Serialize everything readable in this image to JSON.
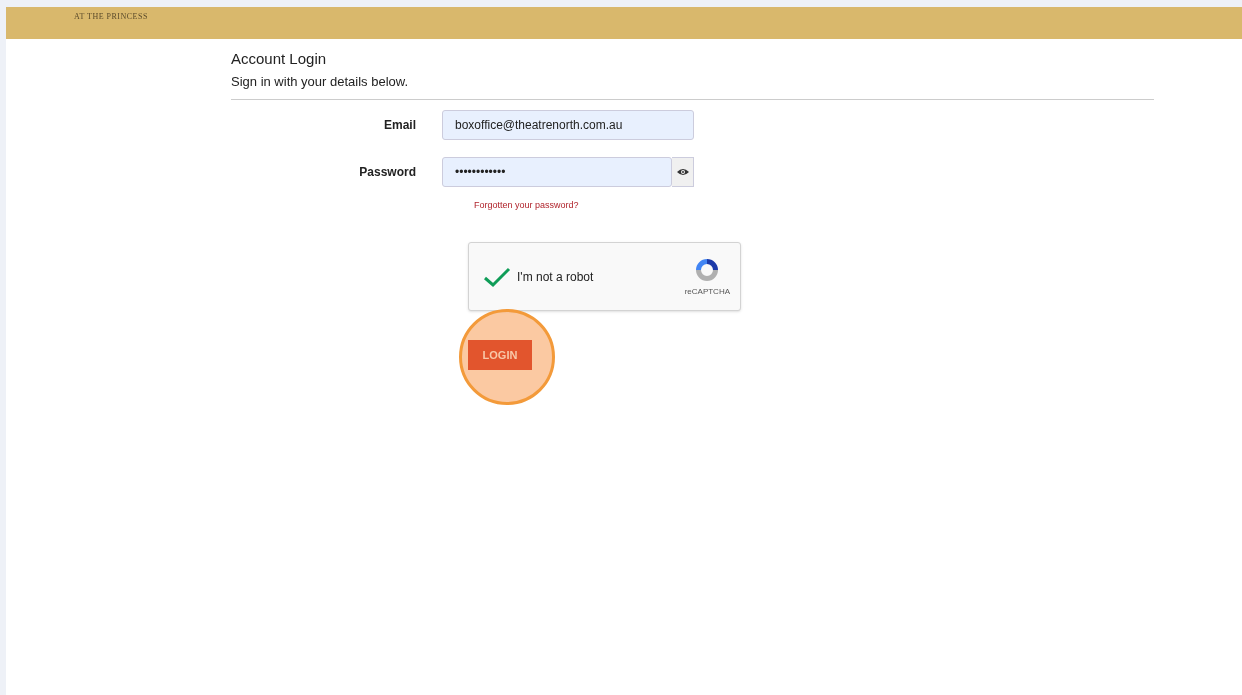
{
  "header": {
    "logo_subtitle": "AT THE PRINCESS"
  },
  "login": {
    "title": "Account Login",
    "subtitle": "Sign in with your details below.",
    "fields": [
      {
        "label": "Email",
        "value": "boxoffice@theatrenorth.com.au",
        "kind": "text"
      },
      {
        "label": "Password",
        "value": "••••••••••••",
        "kind": "password"
      }
    ],
    "forgot_link": "Forgotten your password?",
    "captcha": {
      "label": "I'm not a robot",
      "brand": "reCAPTCHA",
      "checked": true
    },
    "login_button": {
      "label": "LOGIN",
      "highlighted": true
    }
  }
}
